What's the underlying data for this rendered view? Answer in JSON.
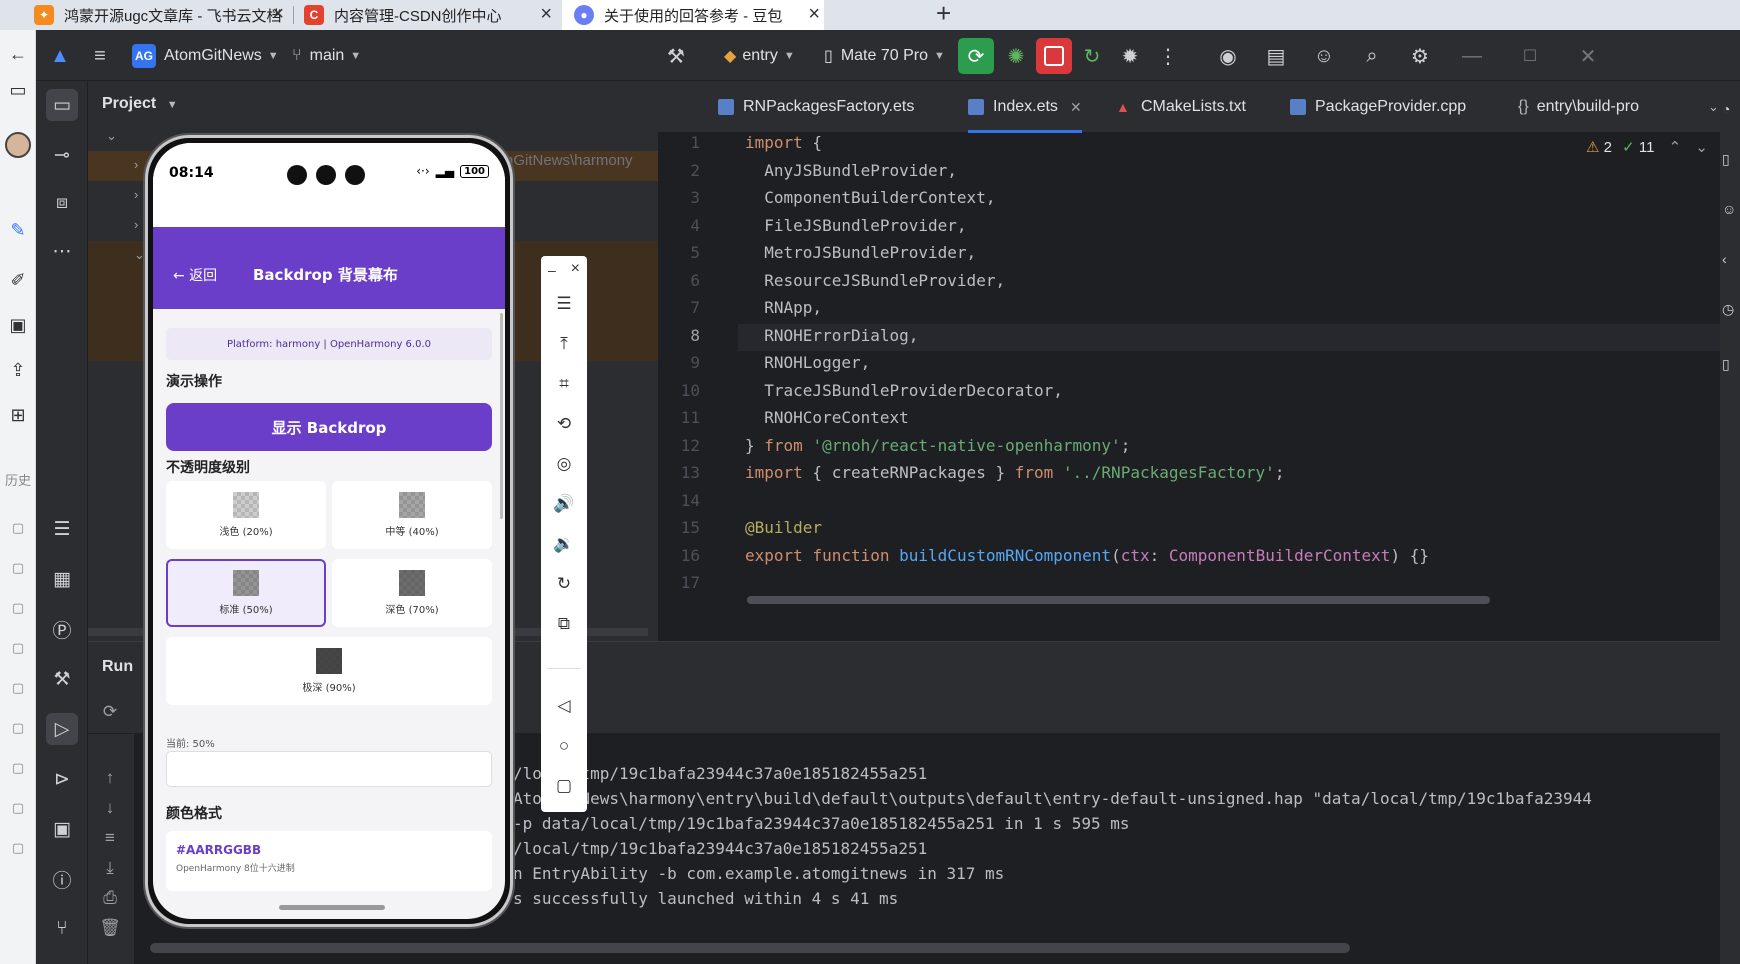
{
  "browser_tabs": [
    {
      "title": "鸿蒙开源ugc文章库 - 飞书云文档",
      "icon": "feishu-icon",
      "color": "#f58b1f"
    },
    {
      "title": "内容管理-CSDN创作中心",
      "icon": "csdn-icon",
      "color": "#e1432f"
    },
    {
      "title": "关于使用的回答参考 - 豆包",
      "icon": "doubao-icon",
      "color": "#6b7ef5"
    }
  ],
  "header": {
    "project_badge": "AG",
    "project_name": "AtomGitNews",
    "branch": "main",
    "run_config": "entry",
    "device": "Mate 70 Pro"
  },
  "project_panel": {
    "title": "Project",
    "path_hint": "nGitNews\\harmony"
  },
  "editor": {
    "tabs": [
      {
        "label": "RNPackagesFactory.ets"
      },
      {
        "label": "Index.ets",
        "active": true
      },
      {
        "label": "CMakeLists.txt"
      },
      {
        "label": "PackageProvider.cpp"
      },
      {
        "label": "entry\\build-pro"
      }
    ],
    "warnings": "2",
    "checks": "11",
    "lines": [
      "import {",
      "  AnyJSBundleProvider,",
      "  ComponentBuilderContext,",
      "  FileJSBundleProvider,",
      "  MetroJSBundleProvider,",
      "  ResourceJSBundleProvider,",
      "  RNApp,",
      "  RNOHErrorDialog,",
      "  RNOHLogger,",
      "  TraceJSBundleProviderDecorator,",
      "  RNOHCoreContext",
      "} from '@rnoh/react-native-openharmony';",
      "import { createRNPackages } from '../RNPackagesFactory';",
      "",
      "@Builder",
      "export function buildCustomRNComponent(ctx: ComponentBuilderContext) {}",
      ""
    ]
  },
  "run_panel": {
    "title": "Run",
    "log_lines": [
      "/local/tmp/19c1bafa23944c37a0e185182455a251",
      "AtomGitNews\\harmony\\entry\\build\\default\\outputs\\default\\entry-default-unsigned.hap \"data/local/tmp/19c1bafa23944",
      "-p data/local/tmp/19c1bafa23944c37a0e185182455a251 in 1 s 595 ms",
      "/local/tmp/19c1bafa23944c37a0e185182455a251",
      "n EntryAbility -b com.example.atomgitnews in 317 ms",
      "s successfully launched within 4 s 41 ms"
    ]
  },
  "phone": {
    "time": "08:14",
    "battery": "100",
    "back_label": "← 返回",
    "title": "Backdrop 背景幕布",
    "platform": "Platform: harmony | OpenHarmony 6.0.0",
    "demo_section": "演示操作",
    "show_button": "显示 Backdrop",
    "opacity_section": "不透明度级别",
    "options": [
      {
        "label": "浅色 (20%)",
        "opacity": 0.2
      },
      {
        "label": "中等 (40%)",
        "opacity": 0.4
      },
      {
        "label": "标准 (50%)",
        "opacity": 0.5,
        "selected": true
      },
      {
        "label": "深色 (70%)",
        "opacity": 0.7
      },
      {
        "label": "极深 (90%)",
        "opacity": 0.9
      }
    ],
    "current": "当前: 50%",
    "color_section": "颜色格式",
    "color_code": "#AARRGGBB",
    "color_desc": "OpenHarmony 8位十六进制"
  }
}
